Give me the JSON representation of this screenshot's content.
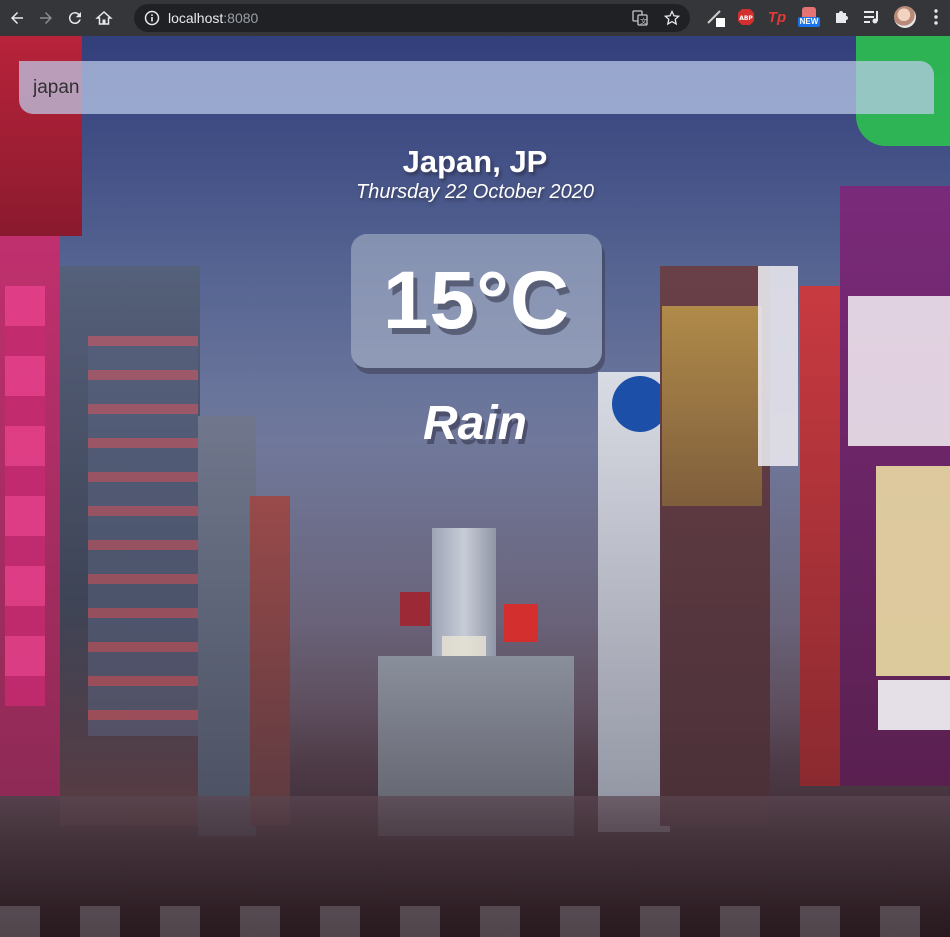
{
  "browser": {
    "url_host": "localhost",
    "url_port": ":8080",
    "extensions": [
      {
        "name": "abp-extension-icon",
        "label": "ABP"
      },
      {
        "name": "tp-extension-icon",
        "label": "Tp"
      },
      {
        "name": "new-extension-icon",
        "label": "NEW"
      }
    ]
  },
  "search": {
    "value": "japan"
  },
  "weather": {
    "location": "Japan, JP",
    "date": "Thursday 22 October 2020",
    "temperature": "15°C",
    "condition": "Rain"
  }
}
